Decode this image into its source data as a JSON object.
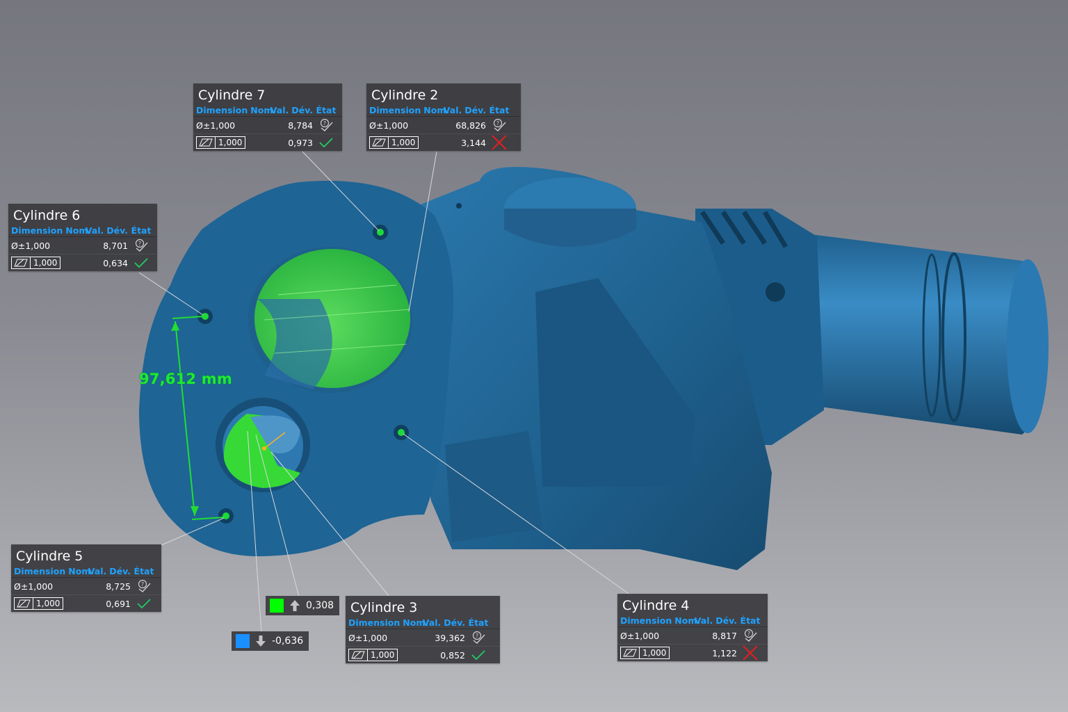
{
  "colors": {
    "part": "#1f5f8c",
    "accent_header": "#1fa2ff",
    "pass": "#22cc66",
    "fail": "#e02020",
    "fit_green": "#33dd33",
    "legend_up": "#00ff00",
    "legend_down": "#1a90ff"
  },
  "headers": {
    "dimension": "Dimension",
    "nom": "Nom.",
    "val": "Val.",
    "dev": "Dév.",
    "etat": "État"
  },
  "callouts": [
    {
      "id": "cyl7",
      "title": "Cylindre 7",
      "row1": {
        "dimension": "Ø±1,000",
        "value": "8,784",
        "state_icon": "question-check-icon"
      },
      "row2": {
        "tolerance": "1,000",
        "value": "0,973",
        "state_icon": "check-icon",
        "state": "pass"
      }
    },
    {
      "id": "cyl2",
      "title": "Cylindre 2",
      "row1": {
        "dimension": "Ø±1,000",
        "value": "68,826",
        "state_icon": "question-check-icon"
      },
      "row2": {
        "tolerance": "1,000",
        "value": "3,144",
        "state_icon": "cross-icon",
        "state": "fail"
      }
    },
    {
      "id": "cyl6",
      "title": "Cylindre 6",
      "row1": {
        "dimension": "Ø±1,000",
        "value": "8,701",
        "state_icon": "question-check-icon"
      },
      "row2": {
        "tolerance": "1,000",
        "value": "0,634",
        "state_icon": "check-icon",
        "state": "pass"
      }
    },
    {
      "id": "cyl5",
      "title": "Cylindre 5",
      "row1": {
        "dimension": "Ø±1,000",
        "value": "8,725",
        "state_icon": "question-check-icon"
      },
      "row2": {
        "tolerance": "1,000",
        "value": "0,691",
        "state_icon": "check-icon",
        "state": "pass"
      }
    },
    {
      "id": "cyl3",
      "title": "Cylindre 3",
      "row1": {
        "dimension": "Ø±1,000",
        "value": "39,362",
        "state_icon": "question-check-icon"
      },
      "row2": {
        "tolerance": "1,000",
        "value": "0,852",
        "state_icon": "check-icon",
        "state": "pass"
      }
    },
    {
      "id": "cyl4",
      "title": "Cylindre 4",
      "row1": {
        "dimension": "Ø±1,000",
        "value": "8,817",
        "state_icon": "question-check-icon"
      },
      "row2": {
        "tolerance": "1,000",
        "value": "1,122",
        "state_icon": "cross-icon",
        "state": "fail"
      }
    }
  ],
  "distance": {
    "label": "97,612 mm"
  },
  "legend": {
    "up": {
      "value": "0,308",
      "icon": "arrow-up-icon"
    },
    "down": {
      "value": "-0,636",
      "icon": "arrow-down-icon"
    }
  }
}
